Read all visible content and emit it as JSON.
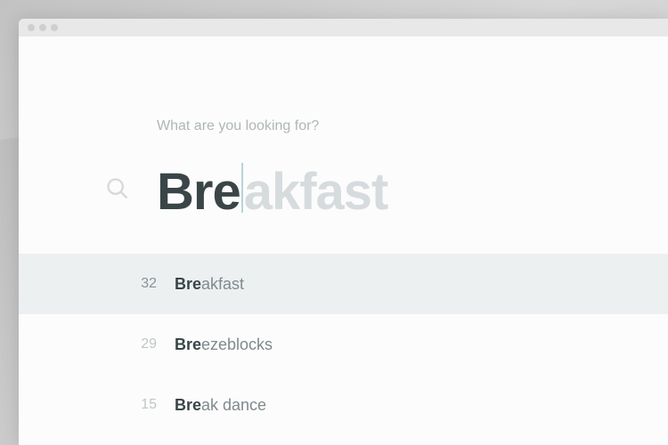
{
  "search": {
    "prompt": "What are you looking for?",
    "typed": "Bre",
    "ghost": "akfast"
  },
  "results": [
    {
      "count": "32",
      "match": "Bre",
      "rest": "akfast",
      "selected": true
    },
    {
      "count": "29",
      "match": "Bre",
      "rest": "ezeblocks",
      "selected": false
    },
    {
      "count": "15",
      "match": "Bre",
      "rest": "ak dance",
      "selected": false
    }
  ]
}
